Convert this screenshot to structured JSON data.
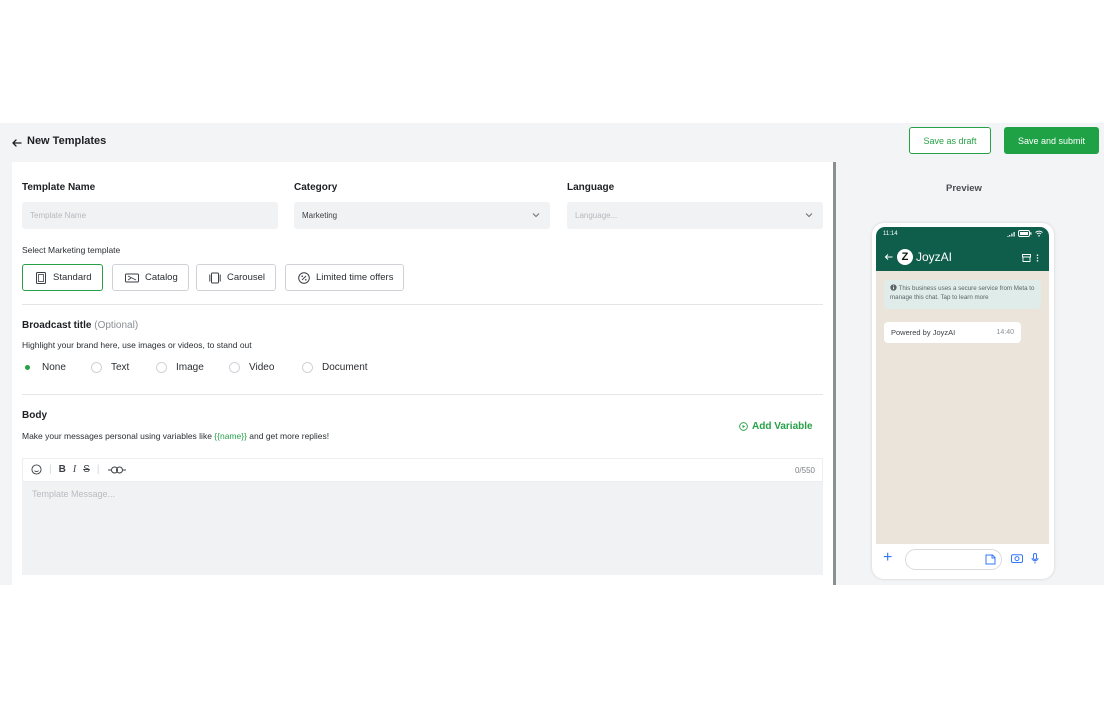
{
  "header": {
    "title": "New Templates",
    "save_draft": "Save as draft",
    "save_submit": "Save and submit"
  },
  "form": {
    "template_name": {
      "label": "Template Name",
      "placeholder": "Template Name",
      "value": ""
    },
    "category": {
      "label": "Category",
      "value": "Marketing"
    },
    "language": {
      "label": "Language",
      "placeholder": "Language..."
    },
    "marketing_template": {
      "label": "Select Marketing template",
      "options": [
        "Standard",
        "Catalog",
        "Carousel",
        "Limited time offers"
      ],
      "selected": "Standard"
    },
    "broadcast": {
      "title": "Broadcast title",
      "optional": "(Optional)",
      "hint": "Highlight your brand here, use images or videos, to stand out",
      "options": [
        "None",
        "Text",
        "Image",
        "Video",
        "Document"
      ],
      "selected": "None"
    },
    "body": {
      "title": "Body",
      "hint_before": "Make your messages personal using variables like ",
      "hint_var": "{{name}}",
      "hint_after": " and get more replies!",
      "add_variable": "Add Variable",
      "counter": "0/550",
      "placeholder": "Template Message..."
    }
  },
  "preview": {
    "label": "Preview",
    "status_time": "11:14",
    "avatar_letter": "Z",
    "business_name": "JoyzAI",
    "notice": "This business uses a secure service from Meta to manage this chat. Tap to learn more",
    "bubble_text": "Powered by JoyzAI",
    "bubble_time": "14:40"
  },
  "colors": {
    "accent": "#27a148",
    "whatsapp_header": "#0e5e4b",
    "chat_background": "#ebe4db"
  }
}
